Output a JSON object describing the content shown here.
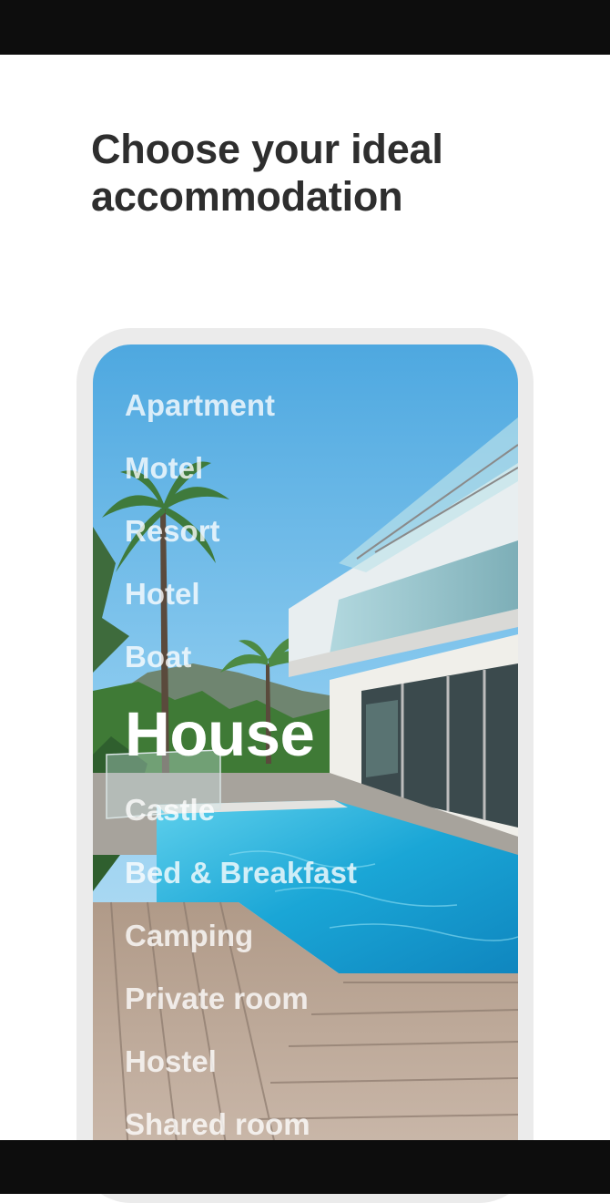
{
  "page": {
    "title": "Choose your ideal accommodation"
  },
  "accommodation_types": [
    {
      "label": "Apartment",
      "selected": false
    },
    {
      "label": "Motel",
      "selected": false
    },
    {
      "label": "Resort",
      "selected": false
    },
    {
      "label": "Hotel",
      "selected": false
    },
    {
      "label": "Boat",
      "selected": false
    },
    {
      "label": "House",
      "selected": true
    },
    {
      "label": "Castle",
      "selected": false
    },
    {
      "label": "Bed & Breakfast",
      "selected": false
    },
    {
      "label": "Camping",
      "selected": false
    },
    {
      "label": "Private room",
      "selected": false
    },
    {
      "label": "Hostel",
      "selected": false
    },
    {
      "label": "Shared room",
      "selected": false
    }
  ],
  "colors": {
    "title_text": "#2e2e2e",
    "device_frame": "#ebebeb",
    "system_bars": "#0d0d0d",
    "list_text": "#ffffff"
  }
}
